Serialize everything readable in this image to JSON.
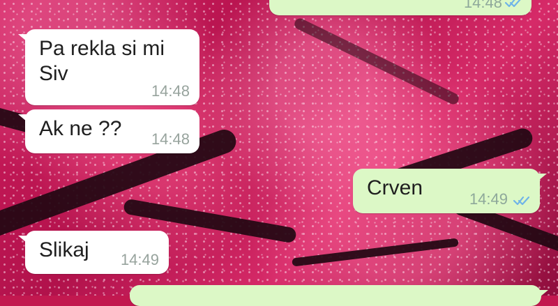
{
  "chat": {
    "messages": [
      {
        "direction": "outgoing",
        "text": "",
        "time": "14:48",
        "ticks": "read"
      },
      {
        "direction": "incoming",
        "text": "Pa rekla si mi\nSiv",
        "time": "14:48"
      },
      {
        "direction": "incoming",
        "text": "Ak ne ??",
        "time": "14:48"
      },
      {
        "direction": "outgoing",
        "text": "Crven",
        "time": "14:49",
        "ticks": "read"
      },
      {
        "direction": "incoming",
        "text": "Slikaj",
        "time": "14:49"
      }
    ]
  },
  "colors": {
    "incoming_bubble": "#ffffff",
    "outgoing_bubble": "#dcf8c6",
    "read_ticks": "#6fb4e8",
    "time_text": "#97a39d"
  },
  "icons": {
    "read_receipt": "double-check-icon"
  }
}
